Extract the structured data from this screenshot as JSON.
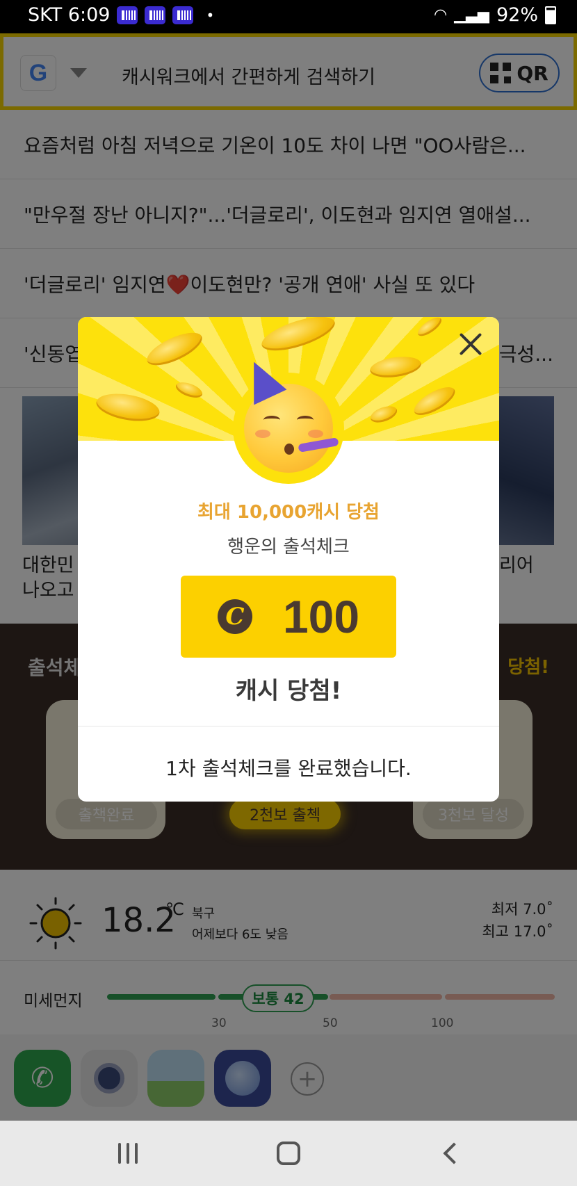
{
  "status_bar": {
    "carrier_time": "SKT 6:09",
    "notification_icons": [
      "barcode-icon",
      "barcode-icon",
      "barcode-icon"
    ],
    "battery": "92%"
  },
  "search": {
    "engine_icon": "G",
    "placeholder": "캐시워크에서 간편하게 검색하기",
    "qr_label": "QR"
  },
  "news": [
    "요즘처럼 아침 저녁으로 기온이 10도 차이 나면 \"OO사람은...",
    "\"만우절 장난 아니지?\"...'더글로리', 이도현과 임지연 열애설...",
    "'더글로리' 임지연❤️이도현만? '공개 연애' 사실 또 있다",
    "'신동엽"
  ],
  "news_tail": "극성...",
  "thumb_captions": {
    "left_line1": "대한민",
    "left_line2": "나오고",
    "right_line1": "리어"
  },
  "attendance": {
    "title_left": "출석체",
    "title_right": "당첨!",
    "pills": [
      "출책완료",
      "2천보 출첵",
      "3천보 달성"
    ]
  },
  "weather": {
    "temperature": "18.2",
    "unit": "℃",
    "region": "북구",
    "comparison": "어제보다 6도 낮음",
    "min": "최저 7.0˚",
    "max": "최고 17.0˚"
  },
  "dust": {
    "label": "미세먼지",
    "badge": "보통 42",
    "value": 42,
    "ticks": [
      "30",
      "50",
      "100"
    ],
    "colors": {
      "good": "#2ea052",
      "normal": "#8fd19e",
      "bad": "#f1b7a6"
    }
  },
  "dock": {
    "apps": [
      "phone-icon",
      "camera-icon",
      "gallery-icon",
      "internet-icon"
    ],
    "add_label": "+"
  },
  "modal": {
    "subtitle": "최대 10,000캐시 당첨",
    "title": "행운의 출석체크",
    "cash_symbol": "C",
    "amount": "100",
    "win_text": "캐시 당첨!",
    "complete_text": "1차 출석체크를 완료했습니다.",
    "accent_color": "#fde10c"
  }
}
